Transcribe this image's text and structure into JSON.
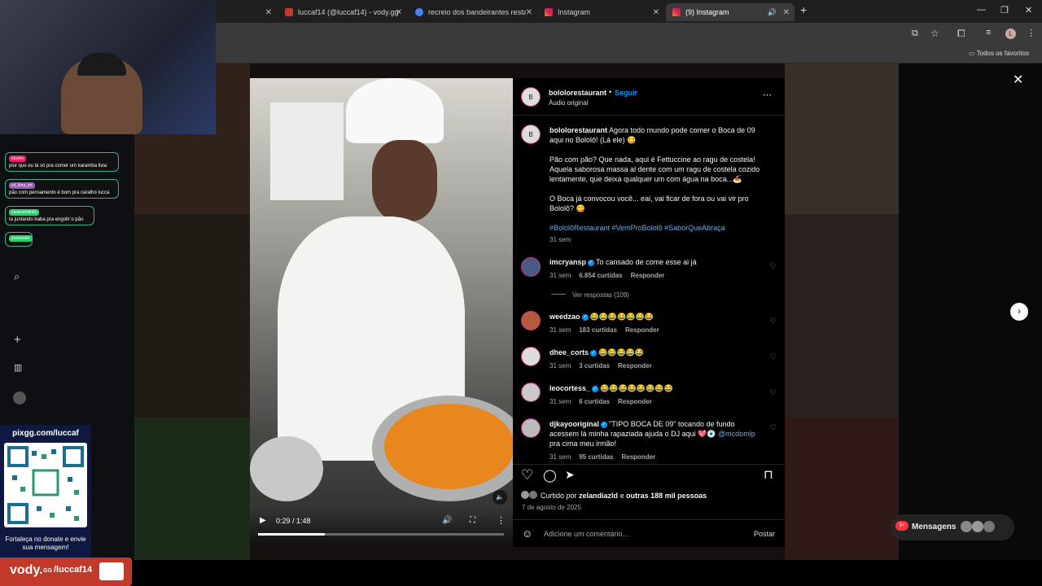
{
  "browser": {
    "tabs": [
      {
        "label": "",
        "active": false
      },
      {
        "label": "luccaf14 (@luccaf14) - vody.gg",
        "active": false
      },
      {
        "label": "recreio dos bandeirantes restau",
        "active": false
      },
      {
        "label": "Instagram",
        "active": false
      },
      {
        "label": "(9) Instagram",
        "active": true
      }
    ],
    "new_tab": "+",
    "bookmarks_folder": "Todos os favoritos",
    "profile_initial": "L"
  },
  "stream": {
    "chat": [
      {
        "badge": "bluehe",
        "text": "pior que eu lá só pra comer um karamba livia"
      },
      {
        "badge": "cú_lima_ph",
        "text": "pão com pensamento é bom pra caralho lucca"
      },
      {
        "badge": "casaruentinho",
        "text": "ta juntando baba pra engolir o pão"
      },
      {
        "badge": "preeseder",
        "text": ""
      }
    ],
    "donate_url": "pixgg.com/luccaf",
    "donate_text": "Fortaleça no donate e envie sua mensagem!",
    "brand": "vody.",
    "brand_suffix": "GG",
    "brand_path": "/luccaf14"
  },
  "video": {
    "time": "0:29 / 1:48",
    "progress": 0.27
  },
  "post": {
    "account": "bololorestaurant",
    "follow": "Seguir",
    "audio": "Áudio original",
    "caption_p1": "Agora todo mundo pode comer o Boca de 09 aqui no Bololô! (Lá ele) 😋",
    "caption_p2": "Pão com pão? Que nada, aqui é Fettuccine ao ragu de costela! Aquela saborosa massa al dente com um ragu de costela cozido lentamente, que deixa qualquer um com água na boca...🍝",
    "caption_p3": "O Boca já convocou você... eai, vai ficar de fora ou vai vir pro Bololô? 😋",
    "hashtags": "#BololôRestaurant #VemProBololô #SaborQueAbraça",
    "caption_time": "31 sem",
    "comments": [
      {
        "user": "imcryansp",
        "text": "To cansado de come esse ai já",
        "time": "31 sem",
        "likes": "6.854 curtidas",
        "reply": "Responder"
      },
      {
        "user": "weedzao",
        "text": "😂😂😂😂😂😂😂",
        "time": "31 sem",
        "likes": "183 curtidas",
        "reply": "Responder"
      },
      {
        "user": "dhee_corts",
        "text": "😂😂😂😂😂",
        "time": "31 sem",
        "likes": "3 curtidas",
        "reply": "Responder"
      },
      {
        "user": "leocortess_",
        "text": "😂😂😂😂😂😂😂😂",
        "time": "31 sem",
        "likes": "6 curtidas",
        "reply": "Responder"
      },
      {
        "user": "djkayooriginal",
        "text": "\"TIPO BOCA DE 09\" tocando de fundo acessem lá minha rapaziada ajuda o DJ aqui 💖💿",
        "mention": "@mcdomlp",
        "text2": "pra cima meu irmão!",
        "time": "31 sem",
        "likes": "95 curtidas",
        "reply": "Responder"
      }
    ],
    "view_replies": "Ver respostas (109)",
    "liked_by_prefix": "Curtido por",
    "liked_by_user": "zelandiazld",
    "liked_by_suffix": "e",
    "liked_by_others": "outras 188 mil pessoas",
    "date": "7 de agosto de 2025",
    "comment_placeholder": "Adicione um comentário...",
    "post_button": "Postar"
  },
  "messages": {
    "label": "Mensagens",
    "badge": "9+"
  },
  "colors": {
    "accent": "#0095f6",
    "chat_border": "#3bb28a",
    "brand_red": "#c0392b"
  }
}
